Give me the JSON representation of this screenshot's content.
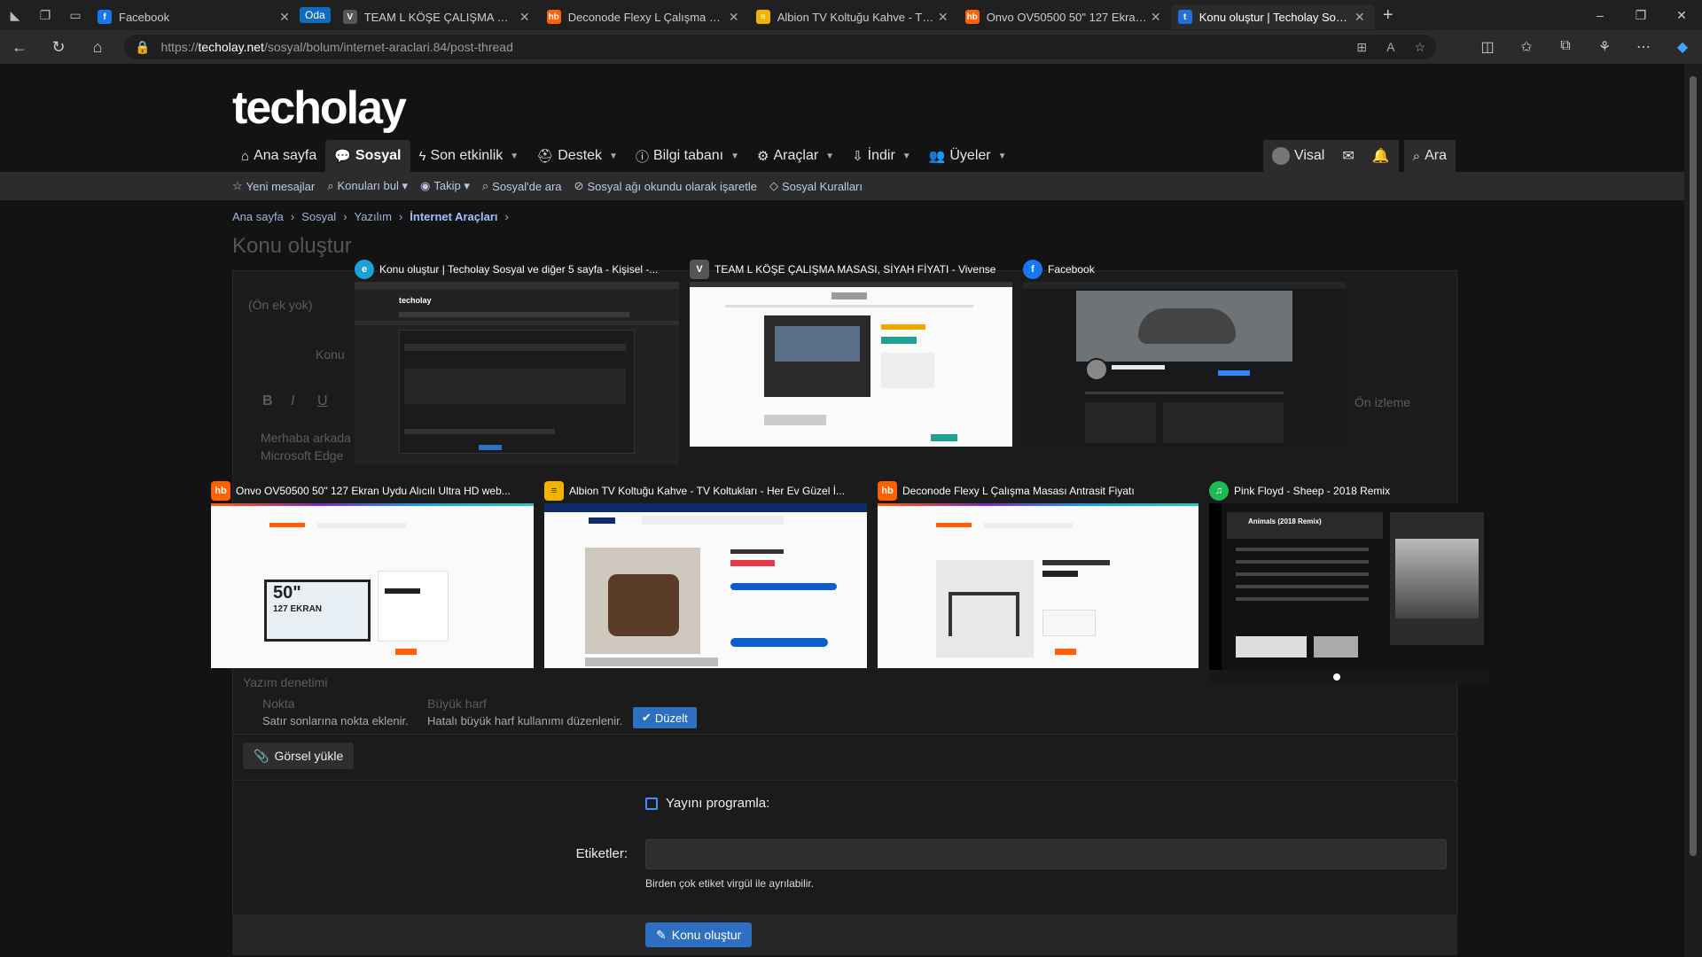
{
  "browser": {
    "tabs": [
      {
        "favicon": "facebook-icon",
        "fav_color": "#1877f2",
        "fav_text": "f",
        "title": "Facebook"
      },
      {
        "favicon": "vivense-icon",
        "fav_color": "#555555",
        "fav_text": "V",
        "title": "TEAM L KÖŞE ÇALIŞMA MASASI,"
      },
      {
        "favicon": "hepsiburada-icon",
        "fav_color": "#ff6000",
        "fav_text": "hb",
        "title": "Deconode Flexy L Çalışma Masası"
      },
      {
        "favicon": "istikbal-icon",
        "fav_color": "#f2b300",
        "fav_text": "≡",
        "title": "Albion TV Koltuğu Kahve - TV Ko"
      },
      {
        "favicon": "hepsiburada-icon",
        "fav_color": "#ff6000",
        "fav_text": "hb",
        "title": "Onvo OV50500 50\" 127 Ekran Uy"
      },
      {
        "favicon": "techolay-icon",
        "fav_color": "#1f6fe0",
        "fav_text": "t",
        "title": "Konu oluştur | Techolay Sosyal"
      }
    ],
    "group_label": "Oda",
    "url_prefix": "https://",
    "url_host": "techolay.net",
    "url_path": "/sosyal/bolum/internet-araclari.84/post-thread"
  },
  "site": {
    "logo": "techolay",
    "nav": [
      {
        "icon": "⌂",
        "label": "Ana sayfa",
        "dd": false
      },
      {
        "icon": "💬",
        "label": "Sosyal",
        "dd": false
      },
      {
        "icon": "ϟ",
        "label": "Son etkinlik",
        "dd": true
      },
      {
        "icon": "⛑",
        "label": "Destek",
        "dd": true
      },
      {
        "icon": "ⓘ",
        "label": "Bilgi tabanı",
        "dd": true
      },
      {
        "icon": "⚙",
        "label": "Araçlar",
        "dd": true
      },
      {
        "icon": "⇩",
        "label": "İndir",
        "dd": true
      },
      {
        "icon": "👥",
        "label": "Üyeler",
        "dd": true
      }
    ],
    "user": "Visal",
    "search_label": "Ara",
    "subnav": [
      {
        "icon": "☆",
        "label": "Yeni mesajlar"
      },
      {
        "icon": "⌕",
        "label": "Konuları bul ▾"
      },
      {
        "icon": "◉",
        "label": "Takip ▾"
      },
      {
        "icon": "⌕",
        "label": "Sosyal'de ara"
      },
      {
        "icon": "⊘",
        "label": "Sosyal ağı okundu olarak işaretle"
      },
      {
        "icon": "◇",
        "label": "Sosyal Kuralları"
      }
    ],
    "breadcrumb": [
      "Ana sayfa",
      "Sosyal",
      "Yazılım",
      "İnternet Araçları"
    ],
    "page_title": "Konu oluştur"
  },
  "form_ghost": {
    "prefix": "(Ön ek yok)",
    "konu": "Konu",
    "body1": "Merhaba arkada",
    "body2": "Microsoft Edge",
    "preview": "Ön izleme",
    "spell": "Yazım denetimi",
    "nokta": "Nokta",
    "buyuk": "Büyük harf",
    "nokta_hint": "Satır sonlarına nokta eklenir.",
    "buyuk_hint": "Hatalı büyük harf kullanımı düzenlenir.",
    "duzelt": "Düzelt"
  },
  "form": {
    "upload_label": "Görsel yükle",
    "schedule_label": "Yayını programla:",
    "tags_label": "Etiketler:",
    "tags_hint": "Birden çok etiket virgül ile ayrılabilir.",
    "submit_label": "Konu oluştur"
  },
  "switcher": [
    {
      "title": "Konu oluştur | Techolay Sosyal ve diğer 5 sayfa - Kişisel -...",
      "fav_text": "e",
      "fav_color": "#1ba0d8",
      "favicon": "edge-icon"
    },
    {
      "title": "TEAM L KÖŞE ÇALIŞMA MASASI, SİYAH FİYATI - Vivense",
      "fav_text": "V",
      "fav_color": "#555555",
      "favicon": "vivense-icon"
    },
    {
      "title": "Facebook",
      "fav_text": "f",
      "fav_color": "#1877f2",
      "favicon": "facebook-icon"
    },
    {
      "title": "Onvo OV50500 50\" 127 Ekran Uydu Alıcılı Ultra HD web...",
      "fav_text": "hb",
      "fav_color": "#ff6000",
      "favicon": "hepsiburada-icon"
    },
    {
      "title": "Albion TV Koltuğu Kahve - TV Koltukları - Her Ev Güzel İ...",
      "fav_text": "≡",
      "fav_color": "#f2b300",
      "favicon": "istikbal-icon"
    },
    {
      "title": "Deconode Flexy L Çalışma Masası Antrasit Fiyatı",
      "fav_text": "hb",
      "fav_color": "#ff6000",
      "favicon": "hepsiburada-icon"
    },
    {
      "title": "Pink Floyd - Sheep - 2018 Remix",
      "fav_text": "♫",
      "fav_color": "#1db954",
      "favicon": "spotify-icon"
    }
  ],
  "thumb_text": {
    "tv_big": "50\"",
    "tv_small": "127 EKRAN",
    "spotify_album": "Animals (2018 Remix)"
  }
}
